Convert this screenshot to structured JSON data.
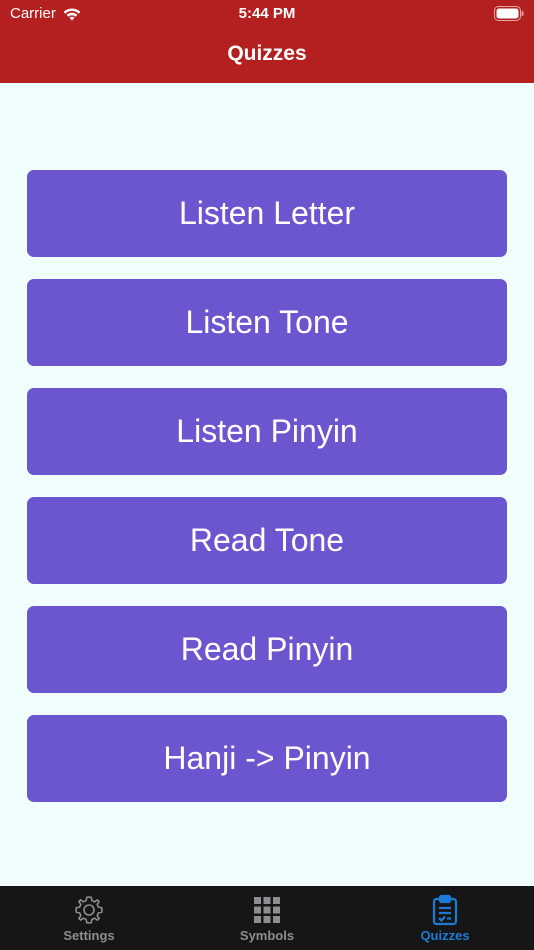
{
  "status_bar": {
    "carrier": "Carrier",
    "time": "5:44 PM"
  },
  "header": {
    "title": "Quizzes"
  },
  "quiz_buttons": [
    {
      "label": "Listen Letter"
    },
    {
      "label": "Listen Tone"
    },
    {
      "label": "Listen Pinyin"
    },
    {
      "label": "Read Tone"
    },
    {
      "label": "Read Pinyin"
    },
    {
      "label": "Hanji -> Pinyin"
    }
  ],
  "tab_bar": {
    "tabs": [
      {
        "label": "Settings",
        "icon": "gear-icon",
        "active": false
      },
      {
        "label": "Symbols",
        "icon": "grid-icon",
        "active": false
      },
      {
        "label": "Quizzes",
        "icon": "clipboard-icon",
        "active": true
      }
    ]
  },
  "colors": {
    "header": "#b3201f",
    "button": "#6c56cf",
    "background": "#f0fffe",
    "tab_bar": "#161616",
    "tab_active": "#1c7bd6",
    "tab_inactive": "#8d8d92"
  }
}
